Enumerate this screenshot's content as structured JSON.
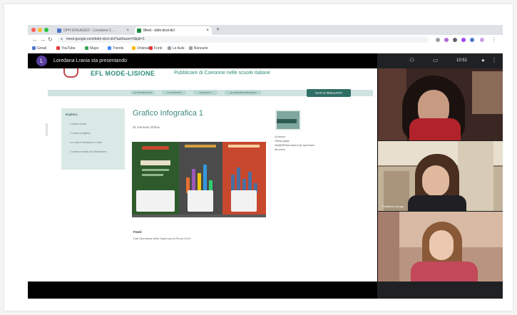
{
  "browser": {
    "tabs": [
      {
        "label": "DPH ENGAGED - Loredana C…",
        "active": false
      },
      {
        "label": "Meet - kdm-dcxt-dcl",
        "active": true
      }
    ],
    "new_tab_label": "+",
    "url": "meet.google.com/kdm-dcxt-dcl?authuser=0&pli=1",
    "bookmarks": [
      "Gmail",
      "YouTube",
      "Maps",
      "Trends",
      "Orisinal",
      "Fonti",
      "Le Aule",
      "Bancarie"
    ]
  },
  "meet": {
    "avatar_letter": "L",
    "presenting_text": "Loredana Lrania sta presentando",
    "clock": "10:51"
  },
  "site": {
    "logo_text": "EFL MODE-LISIONE",
    "tagline": "Pubblicare di Coesione nelle scuole italiane",
    "menu_items": [
      "LE OPPORTUNITÀ",
      "LA COMUNITÀ",
      "I PROGETTI",
      "LE DOMANDE FREQUENTI"
    ],
    "cta": "DATI E RISULTATI",
    "sidebar_title": "Esplora",
    "sidebar_items": [
      "Il nostro team",
      "Il nostro progetto",
      "Le nostre tematiche e fonti",
      "Il nostro metodo di valutazione"
    ],
    "post_title": "Grafico Infografica 1",
    "post_date": "31 Gennaio 2020 ▸",
    "author_lines": [
      "Un lavoro",
      "Ottima guida,",
      "info@DRUM.unipd.it per quel team",
      "del primo"
    ],
    "fonti_label": "Fonti:",
    "fonti_text": "Dati Openbase della Sapienza di Roma 2019"
  },
  "participants": [
    {
      "name": "",
      "tile": "camera"
    },
    {
      "name": "Federica Luongo",
      "tile": "camera"
    },
    {
      "name": "",
      "tile": "camera"
    }
  ],
  "colors": {
    "accent": "#2e8b7a",
    "meet_bg": "#202124",
    "logo_red": "#c0464a"
  }
}
